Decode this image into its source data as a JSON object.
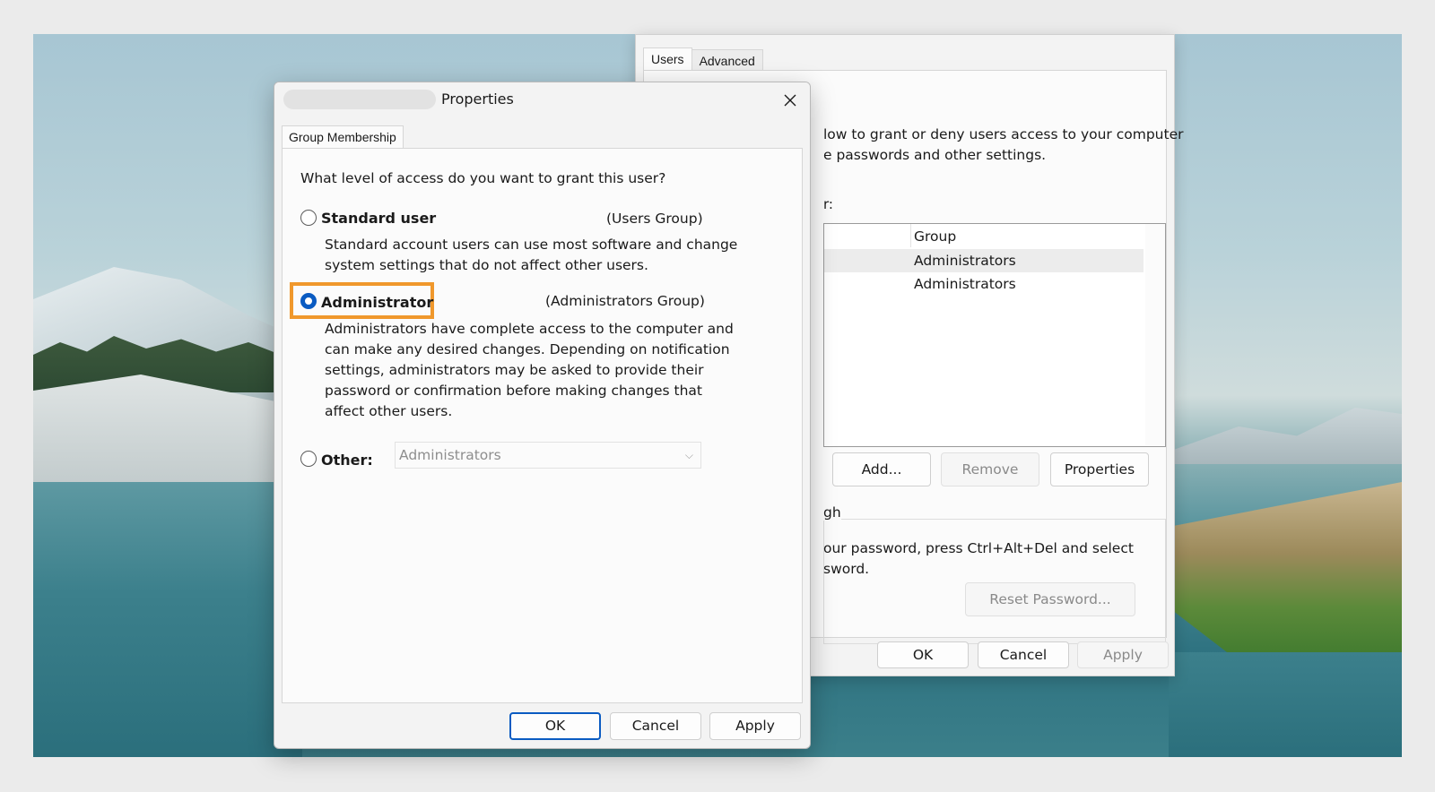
{
  "back_dialog": {
    "tabs": [
      "Users",
      "Advanced"
    ],
    "description_lines": [
      "low to grant or deny users access to your computer",
      "e passwords and other settings."
    ],
    "users_label": "r:",
    "list_header": "Group",
    "list_rows": [
      "Administrators",
      "Administrators"
    ],
    "buttons": {
      "add": "Add...",
      "remove": "Remove",
      "properties": "Properties"
    },
    "group_title": "gh",
    "group_text_lines": [
      "our password, press Ctrl+Alt+Del and select",
      "sword."
    ],
    "reset_password": "Reset Password...",
    "footer": {
      "ok": "OK",
      "cancel": "Cancel",
      "apply": "Apply"
    }
  },
  "front_dialog": {
    "title": "Properties",
    "tab": "Group Membership",
    "question": "What level of access do you want to grant this user?",
    "options": [
      {
        "label": "Standard user",
        "group": "(Users Group)",
        "description_lines": [
          "Standard account users can use most software and change",
          "system settings that do not affect other users."
        ],
        "selected": false
      },
      {
        "label": "Administrator",
        "group": "(Administrators Group)",
        "description_lines": [
          "Administrators have complete access to the computer and",
          "can make any desired changes. Depending on notification",
          "settings, administrators may be asked to provide their",
          "password or confirmation before making changes that",
          "affect other users."
        ],
        "selected": true
      },
      {
        "label": "Other:",
        "selected": false
      }
    ],
    "other_combo_value": "Administrators",
    "footer": {
      "ok": "OK",
      "cancel": "Cancel",
      "apply": "Apply"
    }
  },
  "colors": {
    "accent": "#0a5bc2",
    "highlight": "#f0982c"
  },
  "icons": {
    "close": "close-icon",
    "combo": "chevron-down-icon"
  }
}
